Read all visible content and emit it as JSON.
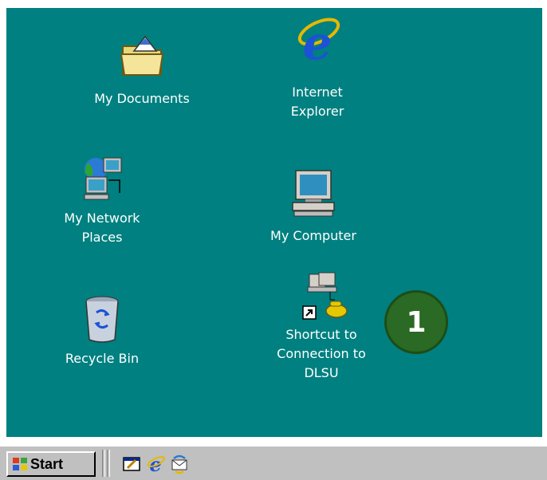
{
  "desktop": {
    "background": "#008080",
    "icons": [
      {
        "label": "My Documents",
        "icon": "folder-documents-icon"
      },
      {
        "label_lines": [
          "Internet",
          "Explorer"
        ],
        "icon": "internet-explorer-icon"
      },
      {
        "label_lines": [
          "My Network",
          "Places"
        ],
        "icon": "network-places-icon"
      },
      {
        "label": "My Computer",
        "icon": "my-computer-icon"
      },
      {
        "label": "Recycle Bin",
        "icon": "recycle-bin-icon"
      },
      {
        "label_lines": [
          "Shortcut to",
          "Connection to",
          "DLSU"
        ],
        "icon": "dialup-connection-shortcut-icon"
      }
    ]
  },
  "callout": {
    "number": "1",
    "color": "#2a6a24"
  },
  "taskbar": {
    "start_label": "Start",
    "quick_launch": [
      "show-desktop-icon",
      "internet-explorer-icon",
      "outlook-express-icon"
    ]
  }
}
